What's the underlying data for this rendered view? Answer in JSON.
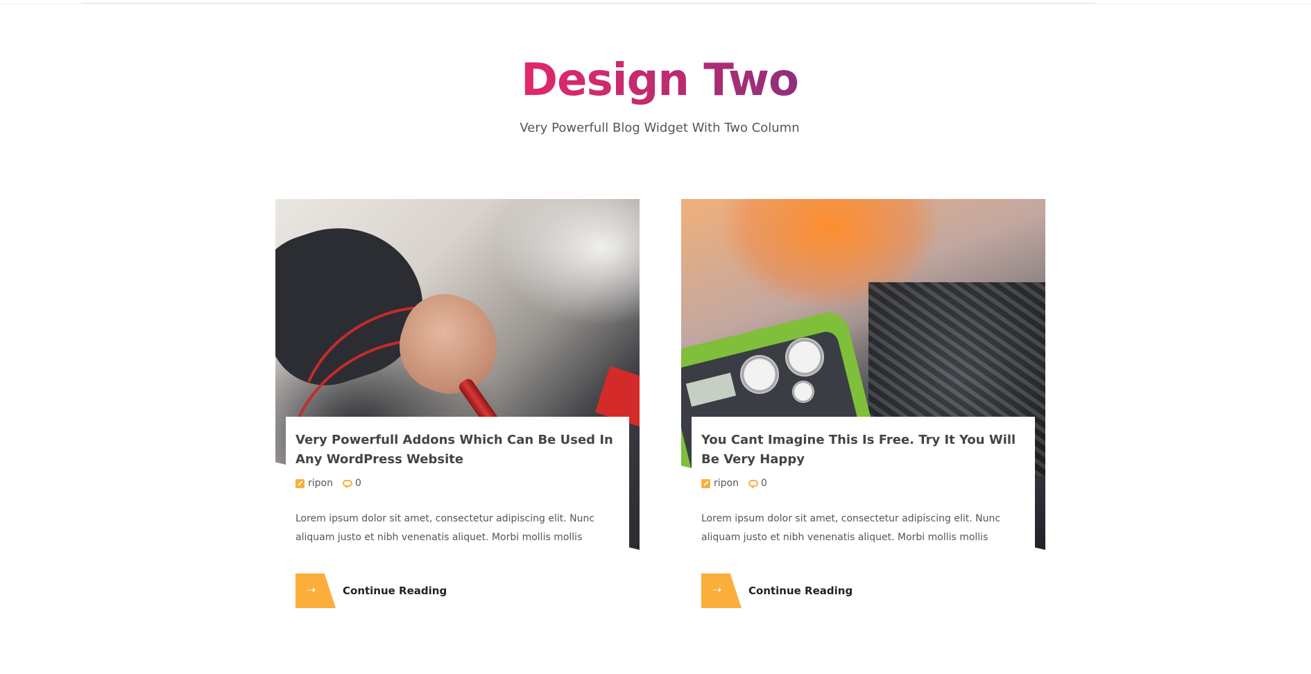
{
  "section": {
    "title": "Design Two",
    "subtitle": "Very Powerfull Blog Widget With Two Column"
  },
  "posts": [
    {
      "title": "Very Powerfull Addons Which Can Be Used In Any WordPress Website",
      "author": "ripon",
      "comments": "0",
      "excerpt": "Lorem ipsum dolor sit amet, consectetur adipiscing elit. Nunc aliquam justo et nibh venenatis aliquet. Morbi mollis mollis",
      "read_more_label": "Continue Reading",
      "image_desc": "mechanic testing car battery"
    },
    {
      "title": "You Cant Imagine This Is Free. Try It You Will Be Very Happy",
      "author": "ripon",
      "comments": "0",
      "excerpt": "Lorem ipsum dolor sit amet, consectetur adipiscing elit. Nunc aliquam justo et nibh venenatis aliquet. Morbi mollis mollis",
      "read_more_label": "Continue Reading",
      "image_desc": "car AC service machine with engine"
    }
  ],
  "icons": {
    "author": "pencil-square-icon",
    "comments": "comment-bubble-icon",
    "read_more": "arrow-right-icon"
  },
  "colors": {
    "title_gradient_start": "#e2286c",
    "title_gradient_end": "#8e2f7c",
    "accent": "#fbae3c",
    "text": "#444444"
  }
}
